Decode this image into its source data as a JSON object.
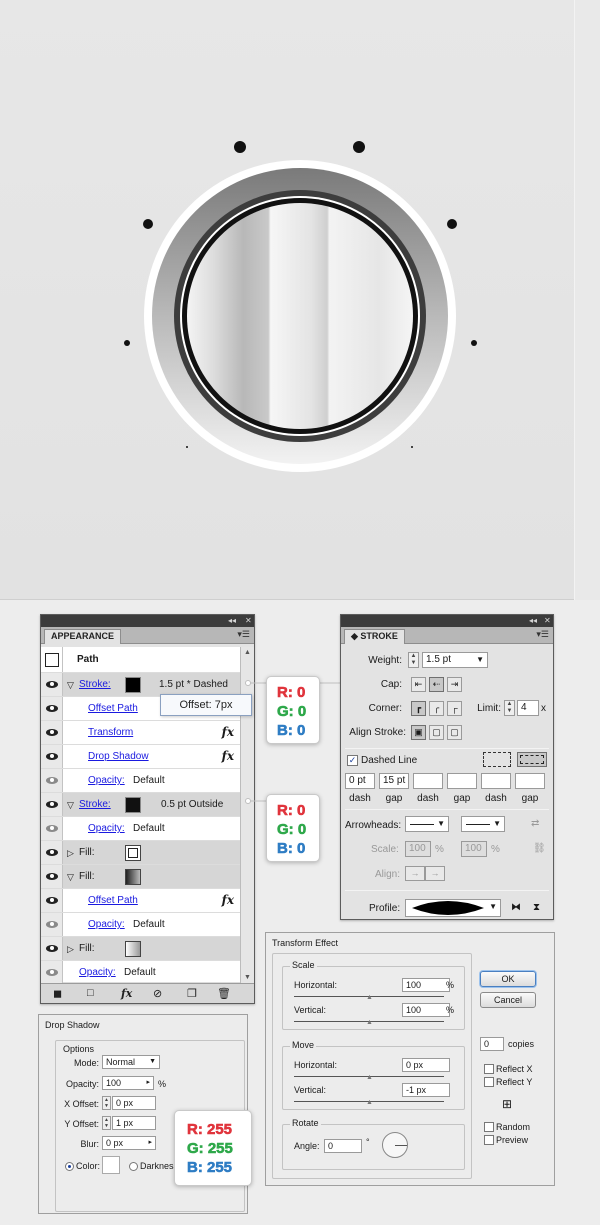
{
  "appearance": {
    "tab_label": "APPEARANCE",
    "header": "Path",
    "rows": [
      {
        "label": "Stroke:",
        "value": "1.5 pt * Dashed"
      },
      {
        "label": "Offset Path"
      },
      {
        "label": "Transform"
      },
      {
        "label": "Drop Shadow"
      },
      {
        "label": "Opacity:",
        "value": "Default"
      },
      {
        "label": "Stroke:",
        "value": "0.5 pt  Outside"
      },
      {
        "label": "Opacity:",
        "value": "Default"
      },
      {
        "label": "Fill:"
      },
      {
        "label": "Fill:"
      },
      {
        "label": "Offset Path"
      },
      {
        "label": "Opacity:",
        "value": "Default"
      },
      {
        "label": "Fill:"
      },
      {
        "label": "Opacity:",
        "value": "Default"
      }
    ],
    "fx_glyph": "fx",
    "tooltip": "Offset: 7px"
  },
  "rgb_callouts": [
    {
      "r": "R: 0",
      "g": "G: 0",
      "b": "B: 0"
    },
    {
      "r": "R: 0",
      "g": "G: 0",
      "b": "B: 0"
    },
    {
      "r": "R: 255",
      "g": "G: 255",
      "b": "B: 255"
    }
  ],
  "stroke": {
    "tab_label": "STROKE",
    "weight_label": "Weight:",
    "weight_value": "1.5 pt",
    "cap_label": "Cap:",
    "corner_label": "Corner:",
    "limit_label": "Limit:",
    "limit_value": "4",
    "limit_unit": "x",
    "align_label": "Align Stroke:",
    "dashed_label": "Dashed Line",
    "dash_values": [
      "0 pt",
      "15 pt",
      "",
      "",
      "",
      ""
    ],
    "dash_labels": [
      "dash",
      "gap",
      "dash",
      "gap",
      "dash",
      "gap"
    ],
    "arrowheads_label": "Arrowheads:",
    "scale_label": "Scale:",
    "scale_values": [
      "100",
      "100"
    ],
    "percent": "%",
    "align_arrow_label": "Align:",
    "profile_label": "Profile:"
  },
  "dropshadow": {
    "title": "Drop Shadow",
    "options_label": "Options",
    "mode_label": "Mode:",
    "mode_value": "Normal",
    "opacity_label": "Opacity:",
    "opacity_value": "100",
    "opacity_unit": "%",
    "xoffset_label": "X Offset:",
    "xoffset_value": "0 px",
    "yoffset_label": "Y Offset:",
    "yoffset_value": "1 px",
    "blur_label": "Blur:",
    "blur_value": "0 px",
    "color_label": "Color:",
    "darkness_label": "Darkness:"
  },
  "transform": {
    "title": "Transform Effect",
    "scale_label": "Scale",
    "horizontal_label": "Horizontal:",
    "scale_h_value": "100",
    "vertical_label": "Vertical:",
    "scale_v_value": "100",
    "percent": "%",
    "move_label": "Move",
    "move_h_value": "0 px",
    "move_v_value": "-1 px",
    "rotate_label": "Rotate",
    "angle_label": "Angle:",
    "angle_value": "0",
    "degree": "°",
    "ok_label": "OK",
    "cancel_label": "Cancel",
    "copies_value": "0",
    "copies_label": "copies",
    "reflect_x_label": "Reflect X",
    "reflect_y_label": "Reflect Y",
    "random_label": "Random",
    "preview_label": "Preview"
  },
  "colors": {
    "r": "#e0343c",
    "g": "#2ea84a",
    "b": "#2f7dc4",
    "link": "#1a1ae0",
    "panel_bg": "#e3e3e3"
  }
}
